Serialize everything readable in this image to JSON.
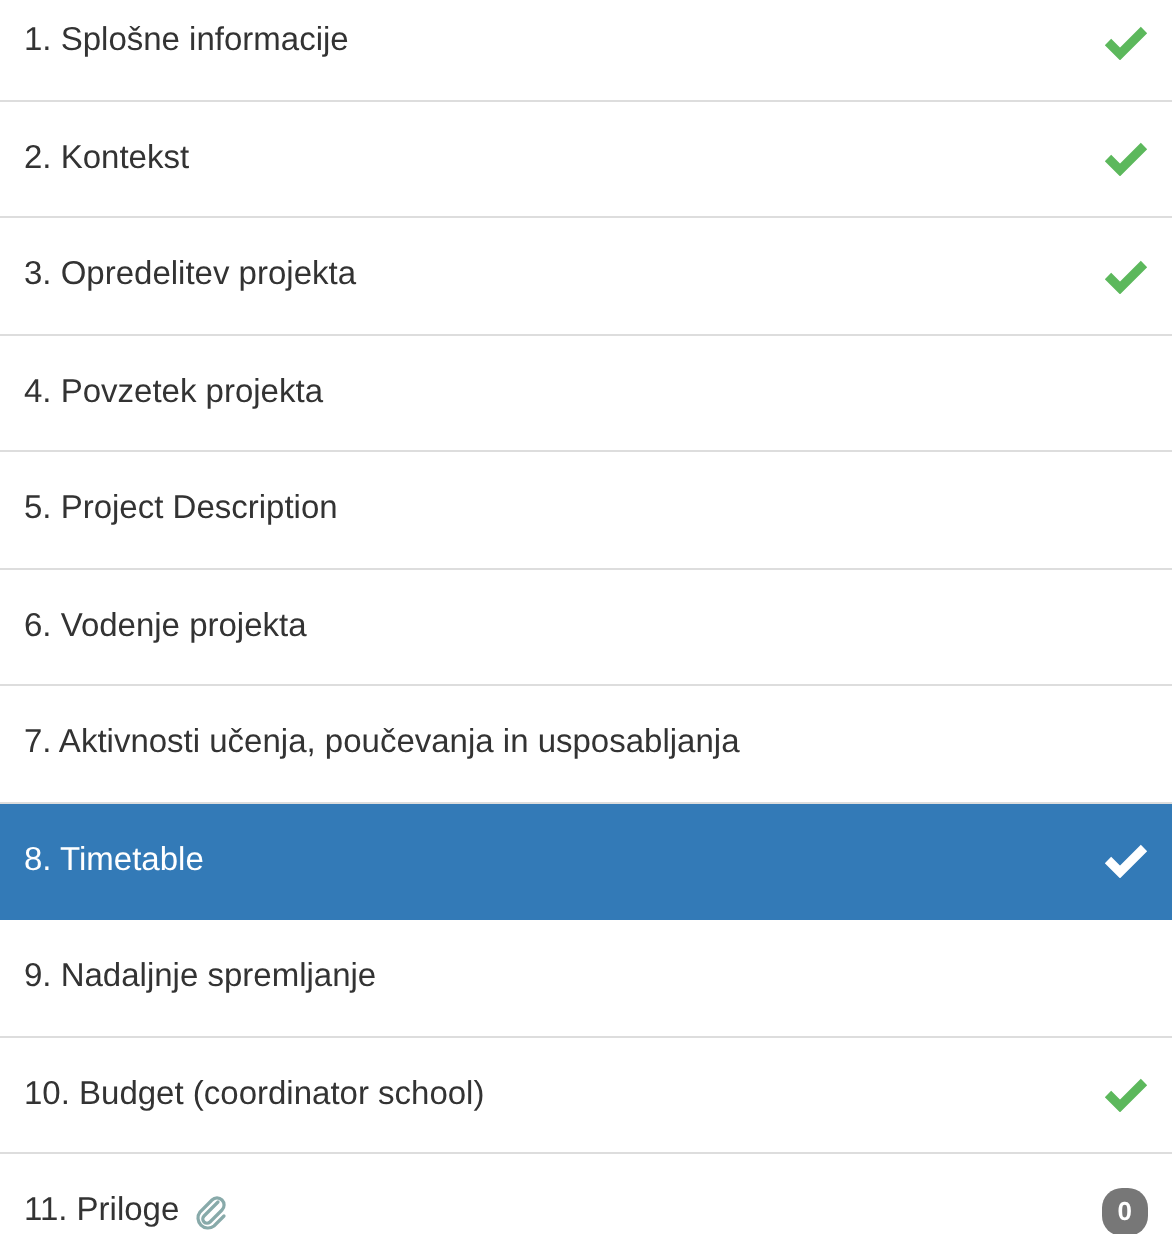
{
  "steps": [
    {
      "label": "1. Splošne informacije",
      "completed": true,
      "selected": false
    },
    {
      "label": "2. Kontekst",
      "completed": true,
      "selected": false
    },
    {
      "label": "3. Opredelitev projekta",
      "completed": true,
      "selected": false
    },
    {
      "label": "4. Povzetek projekta",
      "completed": false,
      "selected": false
    },
    {
      "label": "5. Project Description",
      "completed": false,
      "selected": false
    },
    {
      "label": "6. Vodenje projekta",
      "completed": false,
      "selected": false
    },
    {
      "label": "7. Aktivnosti učenja, poučevanja in usposabljanja",
      "completed": false,
      "selected": false
    },
    {
      "label": "8. Timetable",
      "completed": true,
      "selected": true
    },
    {
      "label": "9. Nadaljnje spremljanje",
      "completed": false,
      "selected": false
    },
    {
      "label": "10. Budget (coordinator school)",
      "completed": true,
      "selected": false
    },
    {
      "label": "11. Priloge",
      "completed": false,
      "selected": false,
      "attachment": true,
      "badge": "0"
    }
  ]
}
